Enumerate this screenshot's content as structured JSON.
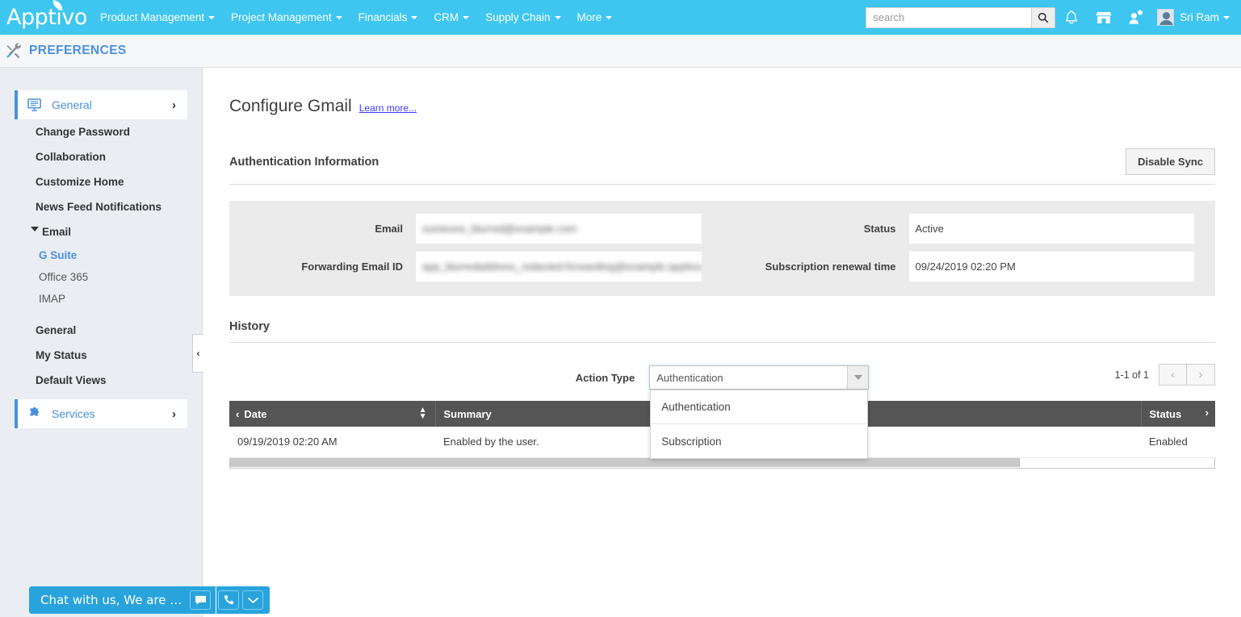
{
  "topnav": {
    "logo_text": "Apptivo",
    "menu": [
      {
        "label": "Product Management",
        "has_caret": true
      },
      {
        "label": "Project Management",
        "has_caret": true
      },
      {
        "label": "Financials",
        "has_caret": true
      },
      {
        "label": "CRM",
        "has_caret": true
      },
      {
        "label": "Supply Chain",
        "has_caret": true
      },
      {
        "label": "More",
        "has_caret": true
      }
    ],
    "search_placeholder": "search",
    "search_value": "",
    "icons": [
      "search-icon",
      "bell-icon",
      "marketplace-icon",
      "add-user-icon"
    ],
    "user_name": "Sri Ram",
    "bg_color": "#3ec6f0"
  },
  "pagebar": {
    "title": "PREFERENCES",
    "icon": "tools-icon",
    "title_color": "#4a90e2"
  },
  "sidebar": {
    "general": {
      "label": "General",
      "icon": "monitor-icon",
      "chevron": "›"
    },
    "links": [
      {
        "label": "Change Password"
      },
      {
        "label": "Collaboration"
      },
      {
        "label": "Customize Home"
      },
      {
        "label": "News Feed Notifications"
      }
    ],
    "email_group": {
      "label": "Email",
      "expanded": true
    },
    "email_children": [
      {
        "label": "G Suite",
        "active": true
      },
      {
        "label": "Office 365",
        "active": false
      },
      {
        "label": "IMAP",
        "active": false
      }
    ],
    "links2": [
      {
        "label": "General"
      },
      {
        "label": "My Status"
      },
      {
        "label": "Default Views"
      }
    ],
    "services": {
      "label": "Services",
      "icon": "puzzle-icon",
      "chevron": "›"
    },
    "collapse_handle": "‹"
  },
  "main": {
    "page_title": "Configure Gmail",
    "learn_more": "Learn more...",
    "auth_section": {
      "title": "Authentication Information",
      "disable_sync_button": "Disable Sync",
      "fields": [
        {
          "label": "Email",
          "value": "someone_blurred@example.com",
          "redacted": true
        },
        {
          "label": "Forwarding Email ID",
          "value": "app_blurredaddress_redacted-forwarding@example.apptivo.com",
          "redacted": true
        },
        {
          "label": "Status",
          "value": "Active",
          "redacted": false
        },
        {
          "label": "Subscription renewal time",
          "value": "09/24/2019 02:20 PM",
          "redacted": false
        }
      ]
    },
    "history_section": {
      "title": "History",
      "filter_label": "Action Type",
      "selected_value": "Authentication",
      "dropdown_open": true,
      "options": [
        "Authentication",
        "Subscription"
      ],
      "pager_text": "1-1 of 1",
      "prev_icon": "‹",
      "next_icon": "›",
      "columns": [
        {
          "label": "Date",
          "sortable": true
        },
        {
          "label": "Summary",
          "sortable": false
        },
        {
          "label": "Status",
          "sortable": false
        }
      ],
      "rows": [
        {
          "date": "09/19/2019 02:20 AM",
          "summary": "Enabled by the user.",
          "status": "Enabled"
        }
      ]
    }
  },
  "chat": {
    "text": "Chat with us, We are …",
    "icons": [
      "chat-bubble-icon",
      "phone-icon",
      "chevron-down-icon"
    ],
    "bg_color": "#29a3dc"
  }
}
